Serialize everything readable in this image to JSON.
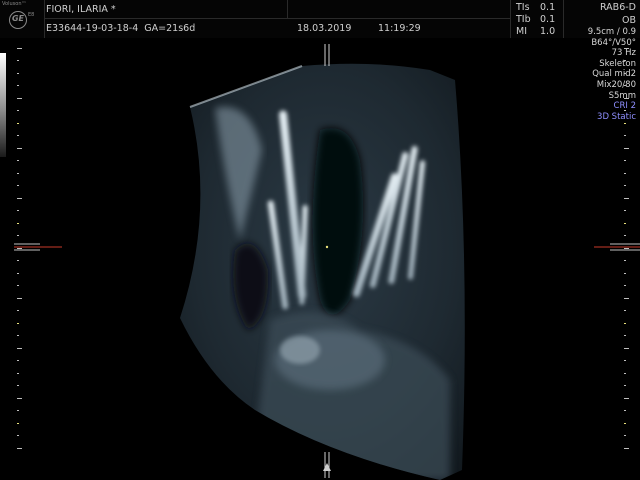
{
  "header": {
    "brand": "Voluson™",
    "model": "E8",
    "ge_logo": "GE",
    "patient_name": "FIORI, ILARIA  *",
    "exam_id": "E33644-19-03-18-4",
    "gestational_age": "GA=21s6d",
    "date": "18.03.2019",
    "time": "11:19:29"
  },
  "indices": [
    {
      "label": "TIs",
      "value": "0.1"
    },
    {
      "label": "TIb",
      "value": "0.1"
    },
    {
      "label": "MI",
      "value": "1.0"
    }
  ],
  "probe": {
    "name": "RAB6-D",
    "preset": "OB"
  },
  "info_panel": [
    "9.5cm / 0.9",
    "B64°/V50°",
    "73 Hz",
    "Skeleton",
    "Qual mid2",
    "Mix20/80",
    "S5mm",
    "CRI 2",
    "3D Static"
  ],
  "colors": {
    "background": "#000000",
    "text": "#d0d0d0",
    "info_accent": "#8f8fff",
    "marker_red": "#c83a2a",
    "tick_yellow": "#e8e07a"
  }
}
